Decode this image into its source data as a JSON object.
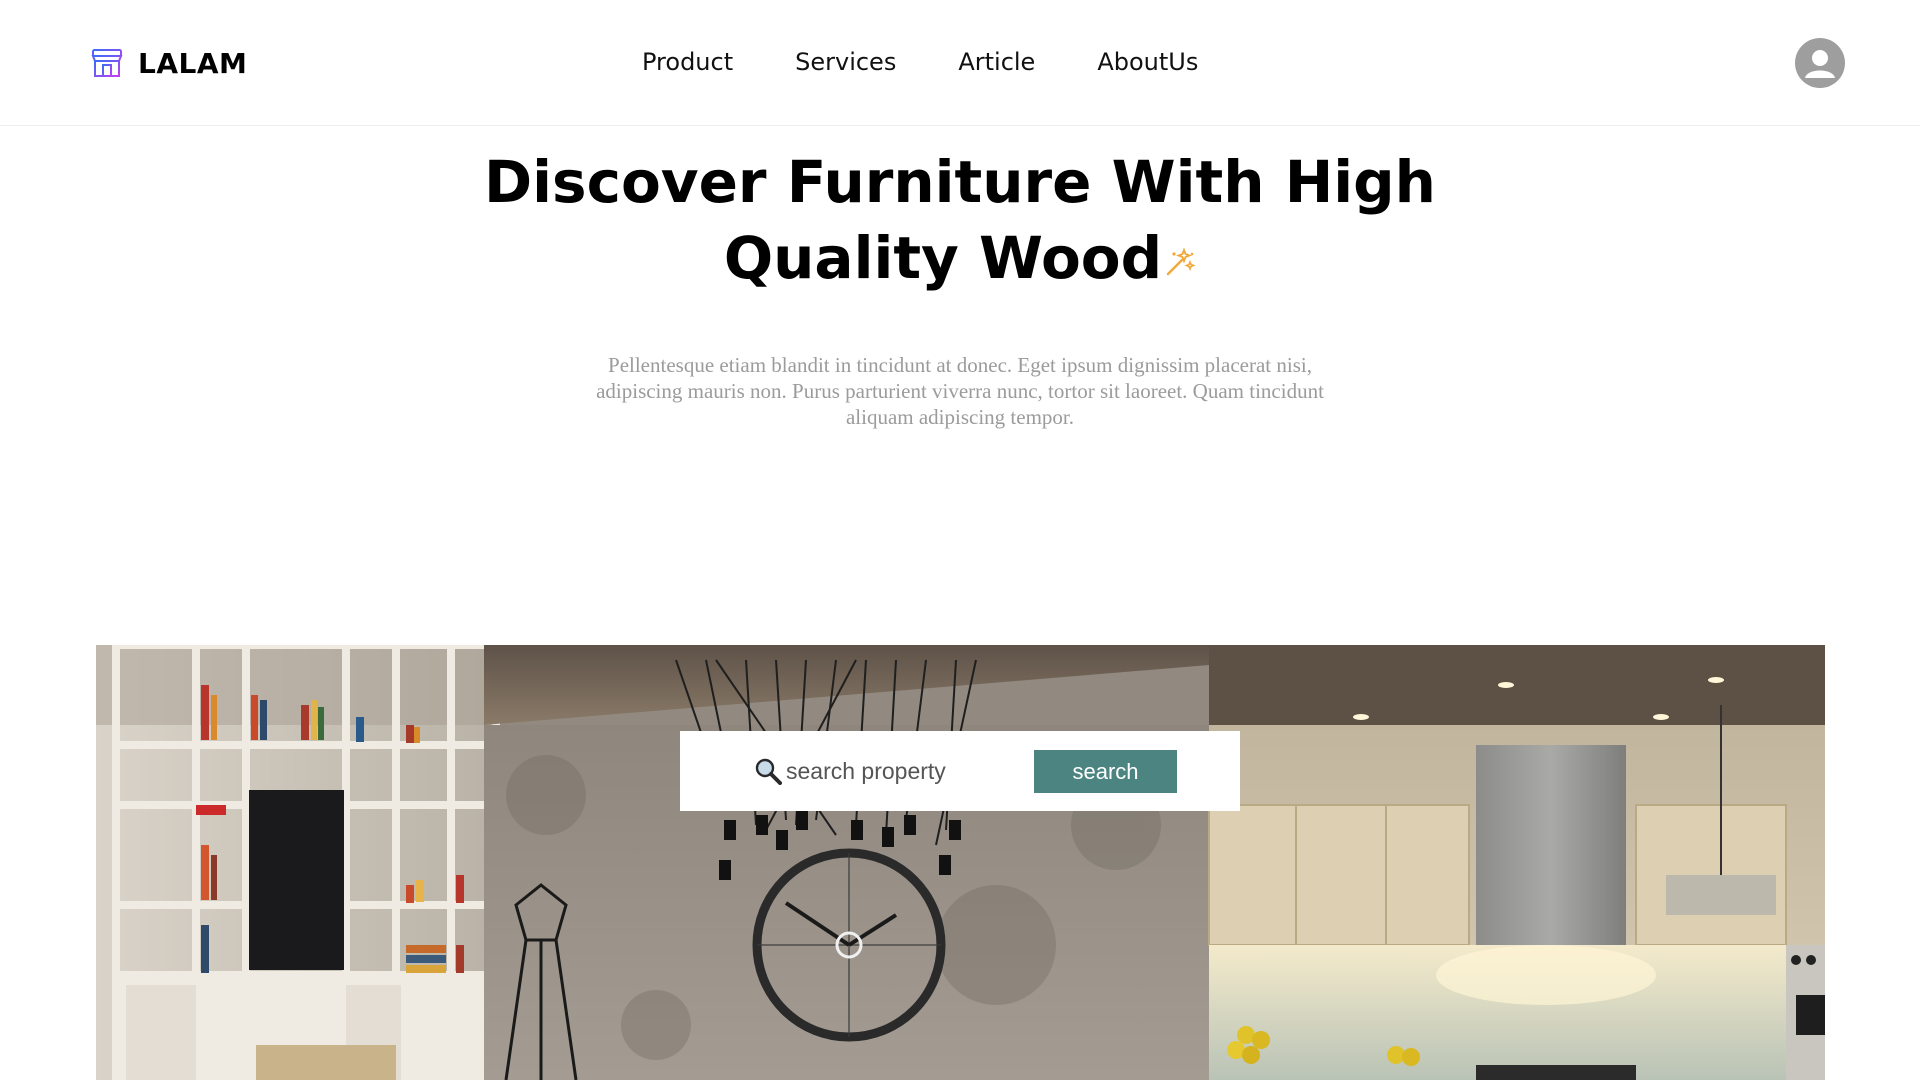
{
  "header": {
    "brand_name": "LALAM",
    "nav": [
      {
        "label": "Product"
      },
      {
        "label": "Services"
      },
      {
        "label": "Article"
      },
      {
        "label": "AboutUs"
      }
    ]
  },
  "hero": {
    "title_line1": "Discover Furniture With High",
    "title_line2": "Quality Wood",
    "subtitle": "Pellentesque etiam blandit in tincidunt at donec. Eget ipsum dignissim placerat nisi, adipiscing mauris non. Purus parturient viverra nunc, tortor sit laoreet. Quam tincidunt aliquam adipiscing tempor."
  },
  "search": {
    "placeholder": "search property",
    "button_label": "search"
  },
  "icons": {
    "brand": "store-icon",
    "avatar": "user-avatar-icon",
    "sparkle": "sparkles-icon",
    "search": "magnifier-icon"
  },
  "colors": {
    "accent": "#4b8480",
    "brand_icon": "#7b3fe4",
    "sparkle": "#f2a93b",
    "subtitle_text": "#9b9b9b",
    "avatar_bg": "#9e9e9e"
  }
}
